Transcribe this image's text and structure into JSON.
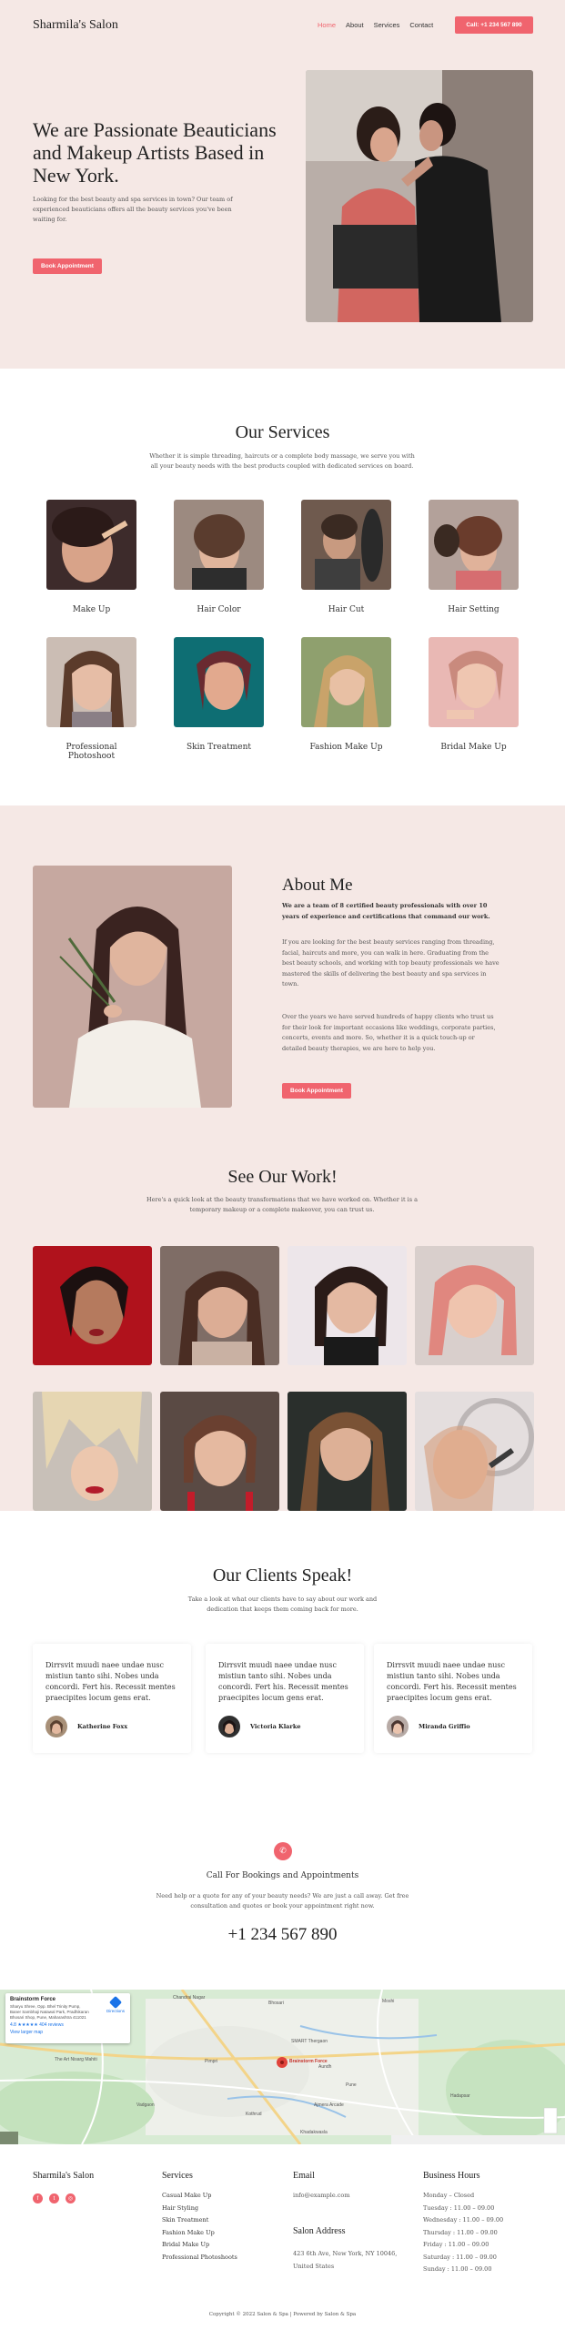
{
  "header": {
    "logo": "Sharmila's Salon",
    "nav": [
      "Home",
      "About",
      "Services",
      "Contact"
    ],
    "call_button": "Call: +1 234 567 890"
  },
  "hero": {
    "title": "We are Passionate Beauticians and Makeup Artists Based in New York.",
    "text": "Looking for the best beauty and spa services in town? Our team of experienced beauticians offers all the beauty services you've been waiting for.",
    "button": "Book Appointment"
  },
  "services": {
    "title": "Our Services",
    "subtitle": "Whether it is simple threading, haircuts or a complete body massage, we serve you with all your beauty needs with the best products coupled with dedicated services on board.",
    "items": [
      "Make Up",
      "Hair Color",
      "Hair Cut",
      "Hair Setting",
      "Professional Photoshoot",
      "Skin Treatment",
      "Fashion Make Up",
      "Bridal Make Up"
    ]
  },
  "about": {
    "title": "About Me",
    "lead": "We are a team of 8 certified beauty professionals with over 10 years of experience and certifications that command our work.",
    "p1": "If you are looking for the best beauty services ranging from threading, facial, haircuts and more, you can walk in here. Graduating from the best beauty schools, and working with top beauty professionals we have mastered the skills of delivering the best beauty and spa services in town.",
    "p2": "Over the years we have served hundreds of happy clients who trust us for their look for important occasions like weddings, corporate parties, concerts, events and more. So, whether it is a quick touch-up or detailed beauty therapies, we are here to help you.",
    "button": "Book Appointment"
  },
  "work": {
    "title": "See Our Work!",
    "subtitle": "Here's a quick look at the beauty transformations that we have worked on. Whether it is a temporary makeup or a complete makeover, you can trust us."
  },
  "testimonials": {
    "title": "Our Clients Speak!",
    "subtitle": "Take a look at what our clients have to say about our work and dedication that keeps them coming back for more.",
    "items": [
      {
        "quote": "Dirrsvit muudi naee undae nusc mistiun tanto sihi. Nobes unda concordi. Fert his. Recessit mentes praecipites locum gens erat.",
        "name": "Katherine Foxx"
      },
      {
        "quote": "Dirrsvit muudi naee undae nusc mistiun tanto sihi. Nobes unda concordi. Fert his. Recessit mentes praecipites locum gens erat.",
        "name": "Victoria Klarke"
      },
      {
        "quote": "Dirrsvit muudi naee undae nusc mistiun tanto sihi. Nobes unda concordi. Fert his. Recessit mentes praecipites locum gens erat.",
        "name": "Miranda Griffio"
      }
    ]
  },
  "contact": {
    "title": "Call For Bookings and Appointments",
    "subtitle": "Need help or a quote for any of your beauty needs? We are just a call away. Get free consultation and quotes or book your appointment right now.",
    "phone": "+1 234 567 890"
  },
  "map": {
    "card_title": "Brainstorm Force",
    "card_address": "Sharyu Shree, Opp. Bhel Trinity Pump, Baner Sambhaji Natawal Park, Pradhikaran Bhosari Shop, Pune, Maharashtra 411021",
    "card_rating": "4.8 ★★★★★ 404 reviews",
    "card_link": "View larger map",
    "directions": "Directions",
    "pin_label": "Brainstorm Force",
    "labels": [
      "Chandrai Nagar",
      "Bhosari",
      "Moshi",
      "SMART Thergaon",
      "Pimpri",
      "Pune",
      "Hadapsar",
      "Kothrud",
      "Aundh",
      "Vadgaon",
      "Khadakwasla",
      "The Art Nisarg Mahiti",
      "Ajmera Arcade"
    ]
  },
  "footer": {
    "logo": "Sharmila's Salon",
    "services_title": "Services",
    "services": [
      "Casual Make Up",
      "Hair Styling",
      "Skin Treatment",
      "Fashion Make Up",
      "Bridal Make Up",
      "Professional Photoshoots"
    ],
    "email_title": "Email",
    "email": "info@example.com",
    "location_title": "Salon Address",
    "address": "423 6th Ave, New York, NY 10046, United States",
    "hours_title": "Business Hours",
    "hours": [
      "Monday – Closed",
      "Tuesday : 11.00 – 09.00",
      "Wednesday : 11.00 – 09.00",
      "Thursday : 11.00 – 09.00",
      "Friday : 11.00 – 09.00",
      "Saturday : 11.00 – 09.00",
      "Sunday : 11.00 – 09.00"
    ],
    "copyright": "Copyright © 2022 Salon & Spa | Powered by Salon & Spa"
  },
  "colors": {
    "accent": "#f0646e",
    "blush_bg": "#f5e8e5"
  }
}
